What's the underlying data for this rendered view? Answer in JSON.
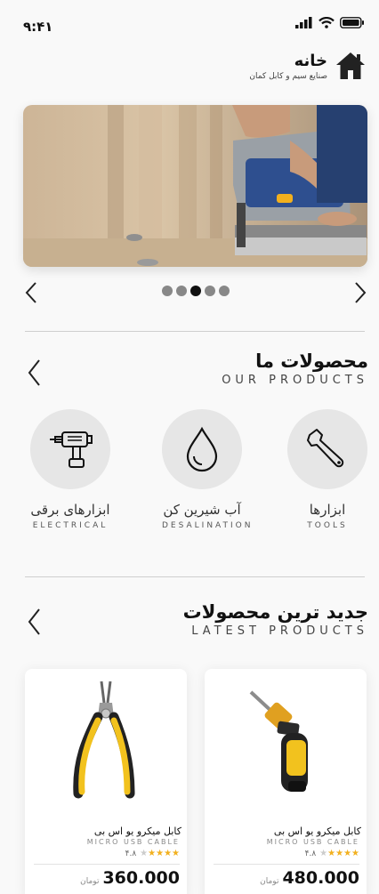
{
  "status": {
    "time": "۹:۴۱"
  },
  "header": {
    "title": "خانه",
    "subtitle": "صنایع سیم و کابل کمان"
  },
  "carousel": {
    "dot_count": 5,
    "active_index": 3
  },
  "products_section": {
    "title": "محصولات ما",
    "subtitle": "OUR PRODUCTS"
  },
  "categories": [
    {
      "label": "ابزارها",
      "en": "TOOLS",
      "icon": "wrench-icon"
    },
    {
      "label": "آب شیرین کن",
      "en": "DESALINATION",
      "icon": "water-drop-icon"
    },
    {
      "label": "ابزارهای برقی",
      "en": "ELECTRICAL",
      "icon": "power-drill-icon"
    }
  ],
  "latest_section": {
    "title": "جدید ترین محصولات",
    "subtitle": "LATEST PRODUCTS"
  },
  "latest_products": [
    {
      "name": "کابل میکرو یو اس بی",
      "en": "MICRO USB CABLE",
      "rating": "۴.۸",
      "stars": 4,
      "price": "480.000",
      "currency": "تومان",
      "icon": "screwdriver-icon"
    },
    {
      "name": "کابل میکرو یو اس بی",
      "en": "MICRO USB CABLE",
      "rating": "۴.۸",
      "stars": 4,
      "price": "360.000",
      "currency": "تومان",
      "icon": "pliers-icon"
    }
  ],
  "colors": {
    "accent_yellow": "#f2b01e",
    "circle_bg": "#e6e6e6",
    "text_dark": "#111111"
  }
}
